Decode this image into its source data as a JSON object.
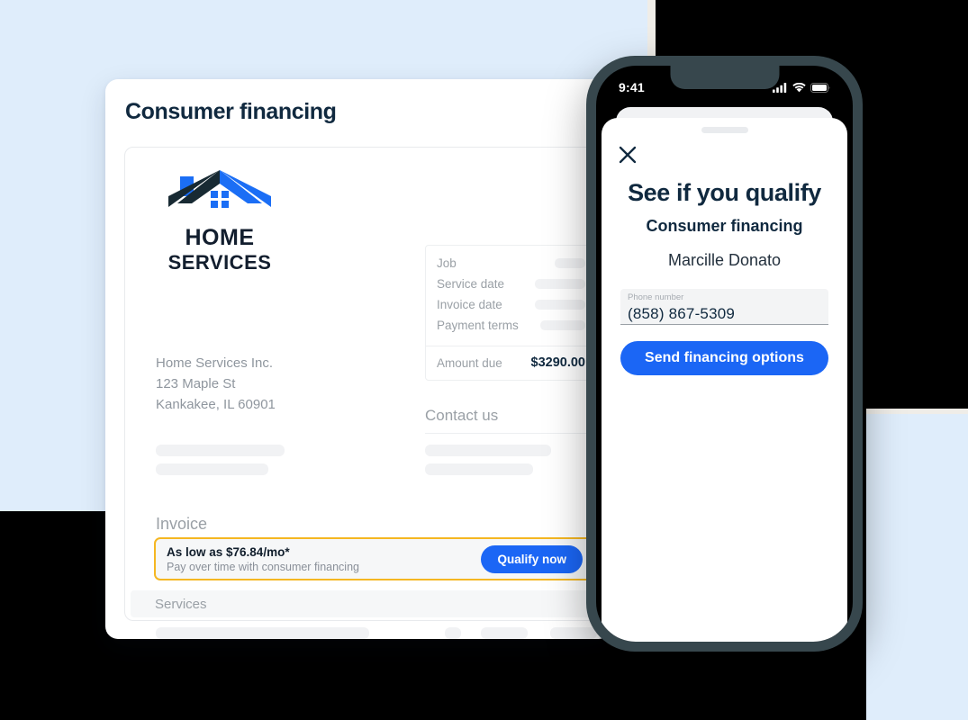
{
  "background": {
    "panel_color": "#DFEDFB",
    "page_color": "#000000"
  },
  "invoice_card": {
    "title": "Consumer financing",
    "logo": {
      "icon_name": "home-services-house-logo",
      "word_top": "HOME",
      "word_bottom": "SERVICES",
      "roof_dark_color": "#182A33",
      "roof_blue_color": "#1B6EF5"
    },
    "business": {
      "name": "Home Services Inc.",
      "street": "123 Maple St",
      "city_state_zip": "Kankakee, IL 60901"
    },
    "details": {
      "rows": [
        {
          "label": "Job",
          "value_width": 34
        },
        {
          "label": "Service date",
          "value_width": 56
        },
        {
          "label": "Invoice date",
          "value_width": 56
        },
        {
          "label": "Payment terms",
          "value_width": 50
        }
      ],
      "amount_label": "Amount due",
      "amount_value": "$3290.00"
    },
    "contact_heading": "Contact us",
    "invoice_label": "Invoice",
    "financing_banner": {
      "headline": "As low as $76.84/mo*",
      "subline": "Pay over time with consumer financing",
      "button_label": "Qualify now",
      "border_color": "#F5B722",
      "button_color": "#1B66F5"
    },
    "services": {
      "header": "Services",
      "rows": [
        {
          "widths": [
            237,
            0,
            18,
            52,
            52
          ]
        },
        {
          "widths": [
            198,
            0,
            18,
            52,
            52
          ]
        }
      ]
    },
    "left_skeleton_widths": [
      143,
      125
    ],
    "right_skeleton_widths": [
      140,
      120
    ]
  },
  "phone": {
    "status_bar": {
      "time": "9:41",
      "signal_icon": "cellular-signal-icon",
      "wifi_icon": "wifi-icon",
      "battery_icon": "battery-icon"
    },
    "sheet": {
      "close_icon": "close-icon",
      "title": "See if you qualify",
      "subtitle": "Consumer financing",
      "customer_name": "Marcille Donato",
      "phone_field": {
        "label": "Phone number",
        "value": "(858) 867-5309",
        "placeholder": "Phone number"
      },
      "submit_label": "Send financing options",
      "submit_color": "#1B66F5"
    }
  }
}
